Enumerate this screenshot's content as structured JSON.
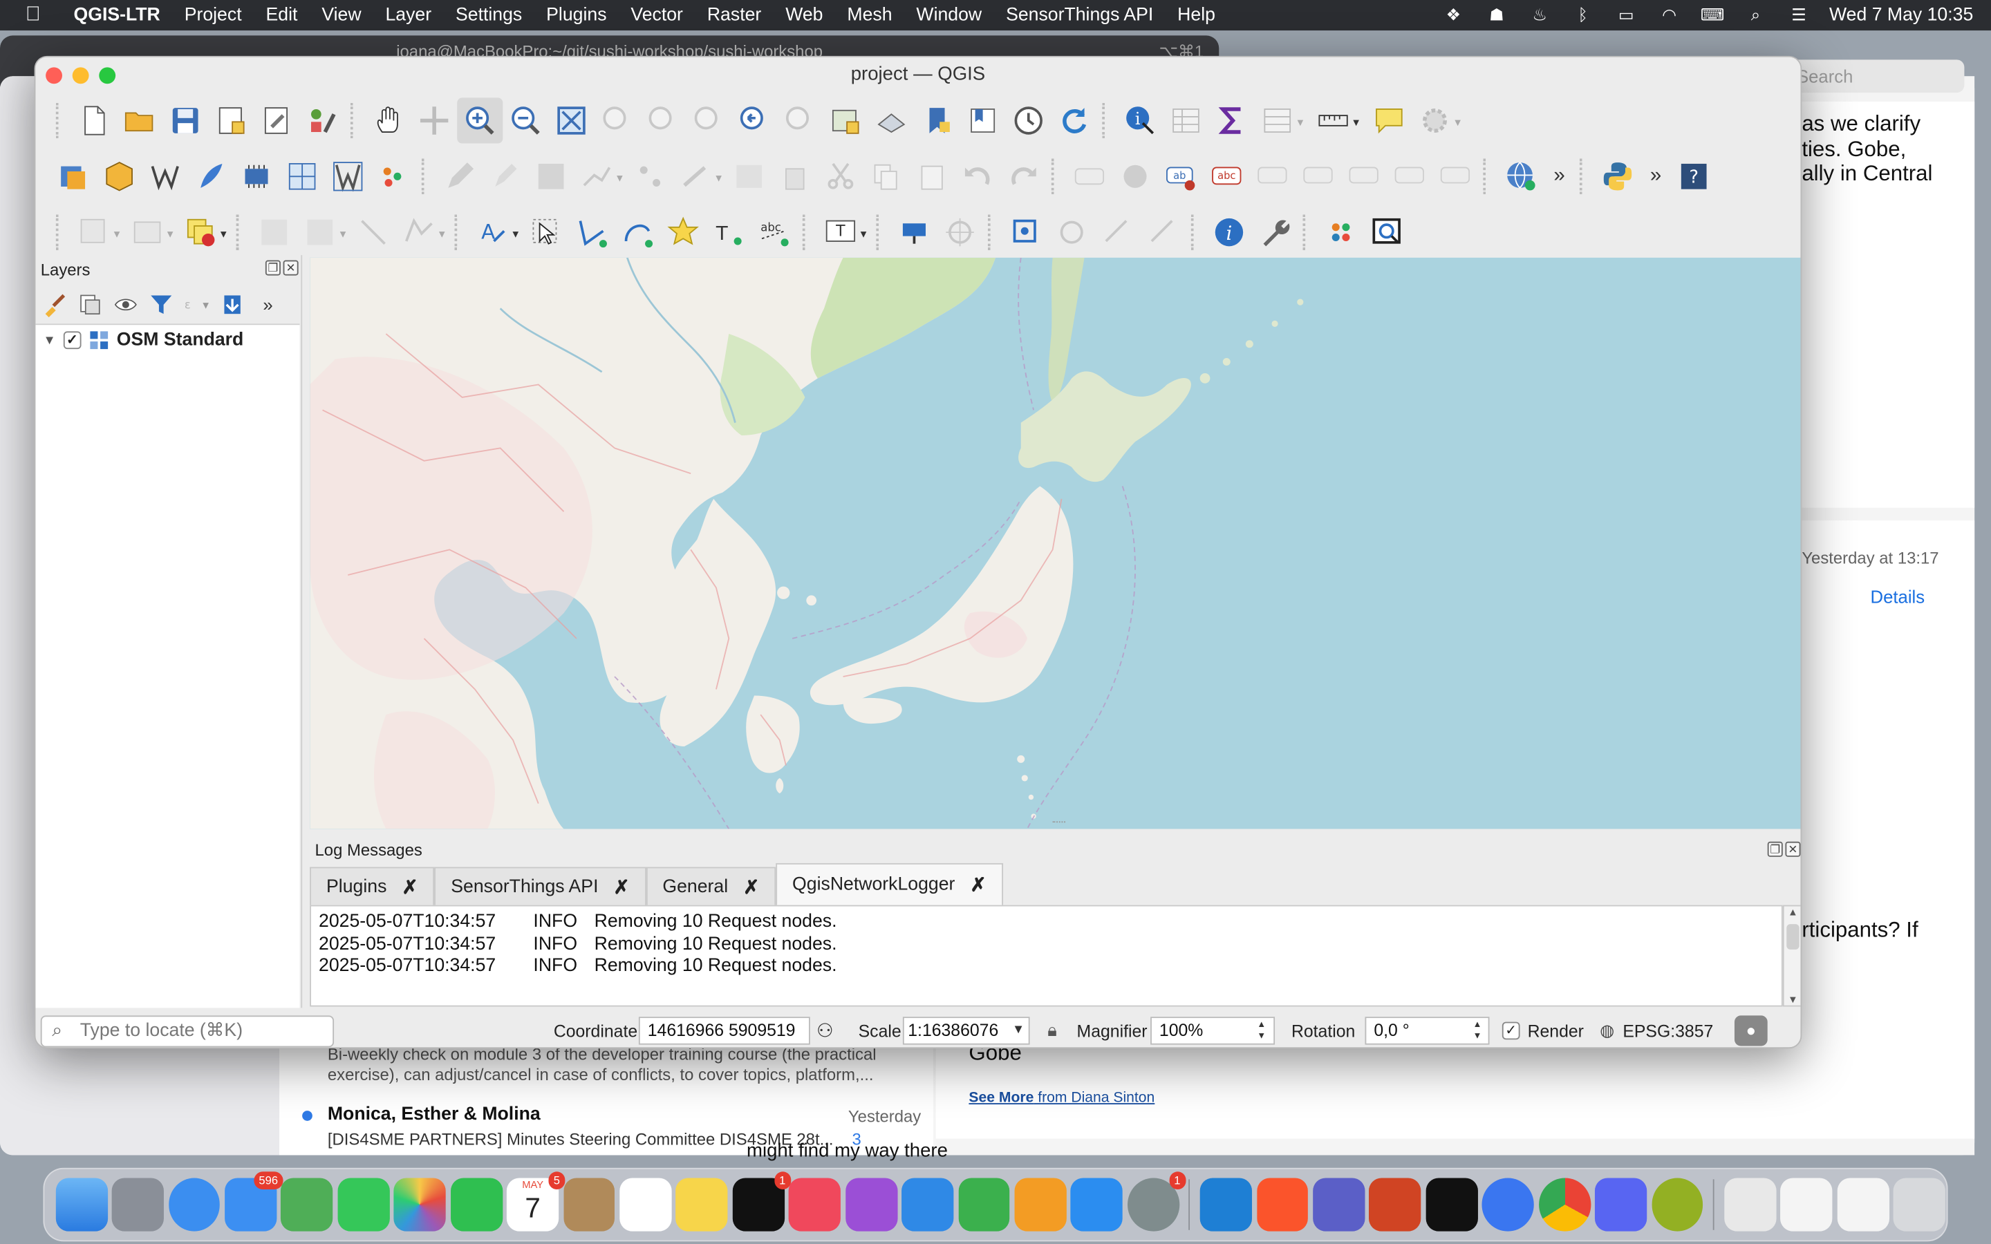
{
  "menubar": {
    "app": "QGIS-LTR",
    "items": [
      "Project",
      "Edit",
      "View",
      "Layer",
      "Settings",
      "Plugins",
      "Vector",
      "Raster",
      "Web",
      "Mesh",
      "Window",
      "SensorThings API",
      "Help"
    ],
    "clock": "Wed 7 May  10:35"
  },
  "background": {
    "terminal_title": "joana@MacBookPro:~/git/sushi-workshop/sushi-workshop",
    "terminal_shortcut": "⌥⌘1",
    "search_placeholder": "Search",
    "mail_text_1": "as we clarify",
    "mail_text_2": "ties.  Gobe,",
    "mail_text_3": "ally in Central",
    "mail_time": "Yesterday at 13:17",
    "mail_details": "Details",
    "mail_participants": "rticipants? If",
    "mail_gobe": "Gobe",
    "see_more": "See More",
    "see_more_from": " from Diana Sinton",
    "list_preview_1": "Bi-weekly check on module 3 of the developer training course (the practical",
    "list_preview_2": "exercise), can adjust/cancel in case of conflicts, to cover topics, platform,...",
    "list_sender": "Monica, Esther & Molina",
    "list_date": "Yesterday",
    "list_subject": "[DIS4SME PARTNERS] Minutes Steering Committee DIS4SME 28t...",
    "list_count": "3",
    "list_below": "might find my way there"
  },
  "qgis": {
    "title": "project — QGIS",
    "layers_panel": {
      "title": "Layers",
      "layer_name": "OSM Standard"
    },
    "log": {
      "title": "Log Messages",
      "tabs": [
        "Plugins",
        "SensorThings API",
        "General",
        "QgisNetworkLogger"
      ],
      "active_tab": "QgisNetworkLogger",
      "lines": [
        {
          "ts": "2025-05-07T10:34:57",
          "level": "INFO",
          "msg": "Removing 10 Request nodes."
        },
        {
          "ts": "2025-05-07T10:34:57",
          "level": "INFO",
          "msg": "Removing 10 Request nodes."
        },
        {
          "ts": "2025-05-07T10:34:57",
          "level": "INFO",
          "msg": "Removing 10 Request nodes."
        }
      ]
    },
    "status": {
      "locator_placeholder": "Type to locate (⌘K)",
      "coordinate_label": "Coordinate",
      "coordinate_value": "14616966  5909519",
      "scale_label": "Scale",
      "scale_value": "1:16386076",
      "magnifier_label": "Magnifier",
      "magnifier_value": "100%",
      "rotation_label": "Rotation",
      "rotation_value": "0,0 °",
      "render_label": "Render",
      "crs": "EPSG:3857"
    },
    "map": {
      "water_color": "#aad3df",
      "land_color": "#f2efe9"
    }
  },
  "dock": {
    "mail_badge": "596",
    "calendar_badge": "5",
    "calendar_month": "MAY",
    "calendar_day": "7",
    "appletv_badge": "1",
    "settings_badge": "1"
  }
}
